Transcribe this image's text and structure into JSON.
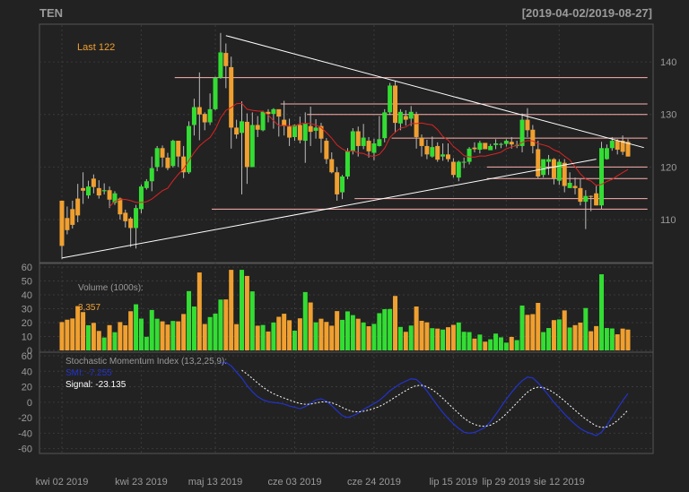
{
  "header": {
    "symbol": "TEN",
    "range": "[2019-04-02/2019-08-27]"
  },
  "price_panel": {
    "last_label": "Last 122"
  },
  "volume_panel": {
    "label": "Volume (1000s):",
    "value": "3,357"
  },
  "smi_panel": {
    "title": "Stochastic Momentum Index (13,2,25,9):",
    "smi_label": "SMI: -7.255",
    "signal_label": "Signal: -23.135"
  },
  "colors": {
    "background": "#222222",
    "up": "#33dd33",
    "down": "#f0a030",
    "grid": "#3a3a3a",
    "trend": "#ffffff",
    "level": "#ffb0b0",
    "ma": "#dd2222",
    "smi": "#2233cc",
    "signal": "#ffffff"
  },
  "chart_data": {
    "type": "candlestick",
    "start_date": "2019-04-02",
    "x_tick_labels": [
      "kwi 02 2019",
      "kwi 23 2019",
      "maj 13 2019",
      "cze 03 2019",
      "cze 24 2019",
      "lip 15 2019",
      "lip 29 2019",
      "sie 12 2019"
    ],
    "x_tick_indices": [
      0,
      15,
      29,
      44,
      59,
      74,
      84,
      94
    ],
    "price": {
      "ylim": [
        102,
        147
      ],
      "yticks": [
        110,
        120,
        130,
        140
      ],
      "ohlc": [
        [
          113.6,
          105.0,
          102.5,
          107.6
        ],
        [
          110.3,
          108.0,
          107.2,
          112.5
        ],
        [
          112.0,
          109.0,
          108.3,
          113.6
        ],
        [
          114.0,
          110.8,
          109.5,
          116.8
        ],
        [
          116.0,
          115.5,
          113.0,
          119.0
        ],
        [
          114.6,
          116.3,
          114.0,
          117.4
        ],
        [
          117.8,
          116.2,
          115.0,
          118.6
        ],
        [
          116.0,
          114.6,
          114.0,
          117.5
        ],
        [
          115.4,
          115.6,
          114.8,
          116.9
        ],
        [
          115.6,
          113.8,
          112.2,
          116.3
        ],
        [
          113.2,
          115.0,
          112.8,
          115.4
        ],
        [
          114.0,
          111.0,
          110.0,
          114.2
        ],
        [
          111.3,
          109.7,
          108.5,
          111.9
        ],
        [
          110.2,
          108.4,
          104.8,
          110.5
        ],
        [
          108.4,
          112.2,
          104.5,
          112.8
        ],
        [
          112.0,
          116.3,
          111.2,
          116.7
        ],
        [
          116.0,
          117.3,
          115.7,
          117.7
        ],
        [
          117.3,
          119.8,
          115.4,
          122.0
        ],
        [
          120.0,
          123.6,
          119.2,
          124.0
        ],
        [
          123.6,
          121.8,
          120.0,
          124.1
        ],
        [
          121.8,
          119.8,
          119.4,
          122.7
        ],
        [
          120.2,
          125.0,
          119.9,
          125.2
        ],
        [
          125.0,
          122.0,
          120.0,
          125.0
        ],
        [
          122.0,
          119.0,
          117.9,
          124.0
        ],
        [
          119.0,
          127.8,
          118.7,
          128.7
        ],
        [
          128.0,
          131.4,
          126.0,
          133.0
        ],
        [
          131.4,
          130.0,
          125.1,
          138.0
        ],
        [
          130.1,
          128.5,
          127.0,
          130.4
        ],
        [
          128.5,
          131.0,
          128.0,
          134.0
        ],
        [
          131.0,
          137.0,
          130.8,
          137.2
        ],
        [
          137.0,
          141.8,
          136.8,
          145.5
        ],
        [
          141.7,
          139.2,
          135.0,
          143.5
        ],
        [
          139.0,
          127.5,
          123.5,
          141.0
        ],
        [
          127.5,
          126.2,
          125.4,
          129.0
        ],
        [
          126.5,
          128.7,
          114.8,
          132.5
        ],
        [
          128.6,
          120.0,
          116.8,
          130.2
        ],
        [
          120.0,
          128.0,
          120.0,
          130.4
        ],
        [
          128.0,
          127.1,
          125.7,
          129.7
        ],
        [
          127.0,
          130.5,
          126.8,
          130.7
        ],
        [
          130.5,
          130.1,
          128.5,
          131.0
        ],
        [
          130.1,
          131.0,
          127.3,
          131.2
        ],
        [
          131.0,
          129.6,
          125.8,
          130.5
        ],
        [
          129.0,
          127.8,
          126.0,
          132.6
        ],
        [
          127.7,
          125.6,
          124.0,
          129.2
        ],
        [
          125.7,
          128.0,
          125.0,
          128.1
        ],
        [
          128.0,
          125.1,
          124.5,
          129.6
        ],
        [
          125.0,
          128.3,
          120.8,
          130.4
        ],
        [
          127.8,
          126.7,
          124.0,
          131.5
        ],
        [
          126.9,
          127.5,
          125.4,
          129.1
        ],
        [
          127.8,
          125.4,
          122.7,
          128.4
        ],
        [
          125.0,
          121.5,
          120.6,
          125.5
        ],
        [
          121.5,
          119.0,
          118.8,
          122.8
        ],
        [
          119.0,
          114.8,
          113.6,
          120.0
        ],
        [
          115.2,
          118.2,
          113.9,
          118.5
        ],
        [
          118.2,
          123.0,
          117.7,
          123.6
        ],
        [
          123.0,
          126.8,
          122.4,
          127.4
        ],
        [
          126.8,
          124.0,
          122.0,
          127.7
        ],
        [
          124.0,
          125.6,
          123.4,
          128.2
        ],
        [
          125.0,
          123.0,
          121.8,
          125.7
        ],
        [
          122.7,
          124.5,
          121.3,
          125.4
        ],
        [
          124.0,
          125.3,
          123.9,
          129.7
        ],
        [
          125.5,
          130.4,
          124.7,
          131.0
        ],
        [
          130.4,
          135.5,
          129.9,
          136.0
        ],
        [
          135.5,
          128.4,
          126.5,
          136.3
        ],
        [
          128.3,
          130.5,
          127.0,
          131.0
        ],
        [
          129.7,
          129.0,
          127.9,
          130.8
        ],
        [
          129.2,
          130.5,
          127.8,
          131.6
        ],
        [
          130.0,
          125.7,
          123.5,
          130.5
        ],
        [
          125.6,
          124.0,
          122.0,
          126.2
        ],
        [
          124.0,
          122.4,
          121.5,
          125.2
        ],
        [
          122.0,
          123.8,
          121.8,
          125.8
        ],
        [
          124.0,
          121.4,
          121.0,
          124.7
        ],
        [
          122.0,
          122.4,
          121.2,
          124.5
        ],
        [
          122.4,
          121.5,
          121.0,
          124.5
        ],
        [
          121.0,
          118.5,
          118.0,
          121.7
        ],
        [
          118.0,
          121.0,
          117.3,
          121.2
        ],
        [
          121.0,
          121.0,
          119.8,
          121.8
        ],
        [
          121.0,
          123.5,
          120.5,
          123.8
        ],
        [
          123.7,
          123.4,
          122.8,
          124.7
        ],
        [
          123.3,
          124.6,
          122.6,
          125.0
        ],
        [
          124.6,
          123.4,
          123.5,
          124.4
        ],
        [
          123.2,
          124.0,
          123.3,
          124.4
        ],
        [
          124.2,
          124.5,
          123.4,
          125.3
        ],
        [
          124.3,
          124.4,
          123.6,
          124.6
        ],
        [
          124.4,
          125.0,
          123.9,
          125.3
        ],
        [
          124.8,
          124.3,
          123.5,
          125.7
        ],
        [
          124.0,
          124.2,
          123.6,
          125.0
        ],
        [
          124.0,
          129.0,
          122.8,
          130.2
        ],
        [
          129.0,
          127.0,
          125.7,
          131.2
        ],
        [
          127.1,
          124.0,
          122.6,
          128.0
        ],
        [
          123.4,
          118.2,
          117.8,
          125.0
        ],
        [
          118.5,
          121.5,
          118.0,
          121.3
        ],
        [
          121.0,
          121.5,
          118.5,
          122.3
        ],
        [
          121.5,
          117.9,
          116.7,
          121.7
        ],
        [
          117.4,
          121.0,
          116.6,
          121.5
        ],
        [
          120.8,
          116.4,
          115.2,
          121.5
        ],
        [
          116.0,
          117.0,
          116.0,
          119.0
        ],
        [
          116.4,
          116.0,
          114.8,
          118.0
        ],
        [
          116.0,
          113.4,
          112.7,
          117.7
        ],
        [
          113.4,
          114.5,
          108.2,
          115.6
        ],
        [
          114.5,
          114.4,
          111.6,
          114.6
        ],
        [
          115.0,
          112.7,
          112.7,
          116.4
        ],
        [
          112.7,
          123.6,
          112.0,
          124.8
        ],
        [
          121.5,
          123.6,
          121.4,
          124.3
        ],
        [
          123.6,
          125.0,
          123.1,
          125.7
        ],
        [
          125.0,
          123.3,
          122.4,
          125.3
        ],
        [
          125.0,
          122.9,
          122.3,
          126.0
        ],
        [
          124.8,
          122.0,
          122.0,
          125.3
        ]
      ],
      "levels": [
        {
          "y": 137.0,
          "from": 22,
          "to": 110
        },
        {
          "y": 132.0,
          "from": 42,
          "to": 110
        },
        {
          "y": 130.0,
          "from": 47,
          "to": 110
        },
        {
          "y": 125.5,
          "from": 63,
          "to": 110
        },
        {
          "y": 120.0,
          "from": 81,
          "to": 110
        },
        {
          "y": 117.8,
          "from": 81,
          "to": 110
        },
        {
          "y": 114.0,
          "from": 56,
          "to": 110
        },
        {
          "y": 112.0,
          "from": 29,
          "to": 110
        }
      ],
      "trendlines": [
        {
          "x1": 0,
          "y1": 102.7,
          "x2": 101,
          "y2": 121.5
        },
        {
          "x1": 31,
          "y1": 145.0,
          "x2": 110,
          "y2": 123.7
        }
      ]
    },
    "volume": {
      "ylim": [
        0,
        60
      ],
      "yticks": [
        0,
        10,
        20,
        30,
        40,
        50,
        60
      ]
    },
    "smi": {
      "ylim": [
        -65,
        60
      ],
      "yticks": [
        -60,
        -40,
        -20,
        0,
        20,
        40,
        60
      ]
    }
  }
}
